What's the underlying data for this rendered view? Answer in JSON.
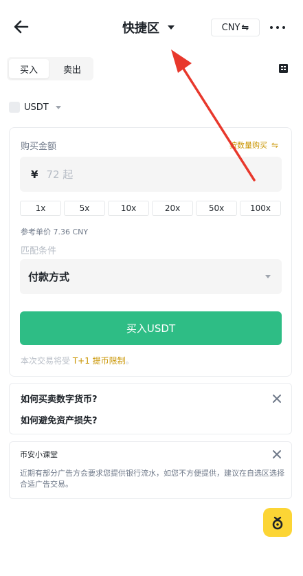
{
  "header": {
    "title": "快捷区",
    "currency_label": "CNY",
    "currency_swap_glyph": "⇋",
    "back_icon": "arrow-left-icon",
    "more_icon": "more-dots-icon"
  },
  "side_toggle": {
    "buy_label": "买入",
    "sell_label": "卖出",
    "selected": "买入"
  },
  "asset": {
    "label": "USDT"
  },
  "trade_form": {
    "amount_label": "购买金额",
    "by_quantity_label": "按数量购买",
    "by_quantity_swap_glyph": "⇋",
    "currency_symbol": "¥",
    "amount_placeholder": "72 起",
    "multipliers": [
      "1x",
      "5x",
      "10x",
      "20x",
      "50x",
      "100x"
    ],
    "reference_price": "参考单价 7.36 CNY",
    "match_label": "匹配条件",
    "payment_method_label": "付款方式",
    "buy_button_label": "买入USDT",
    "notice_prefix": "本次交易将受 ",
    "notice_highlight": "T+1 提币限制",
    "notice_suffix": "。"
  },
  "faq": {
    "questions": [
      "如何买卖数字货币?",
      "如何避免资产损失?"
    ]
  },
  "tip": {
    "title": "币安小课堂",
    "body": "近期有部分广告方会要求您提供银行流水，如您不方便提供，建议在自选区选择合适广告交易。"
  },
  "colors": {
    "primary_green": "#2ebd85",
    "brand_yellow": "#fcd535",
    "highlight_gold": "#c99400",
    "annotation_red": "#e8382c"
  }
}
